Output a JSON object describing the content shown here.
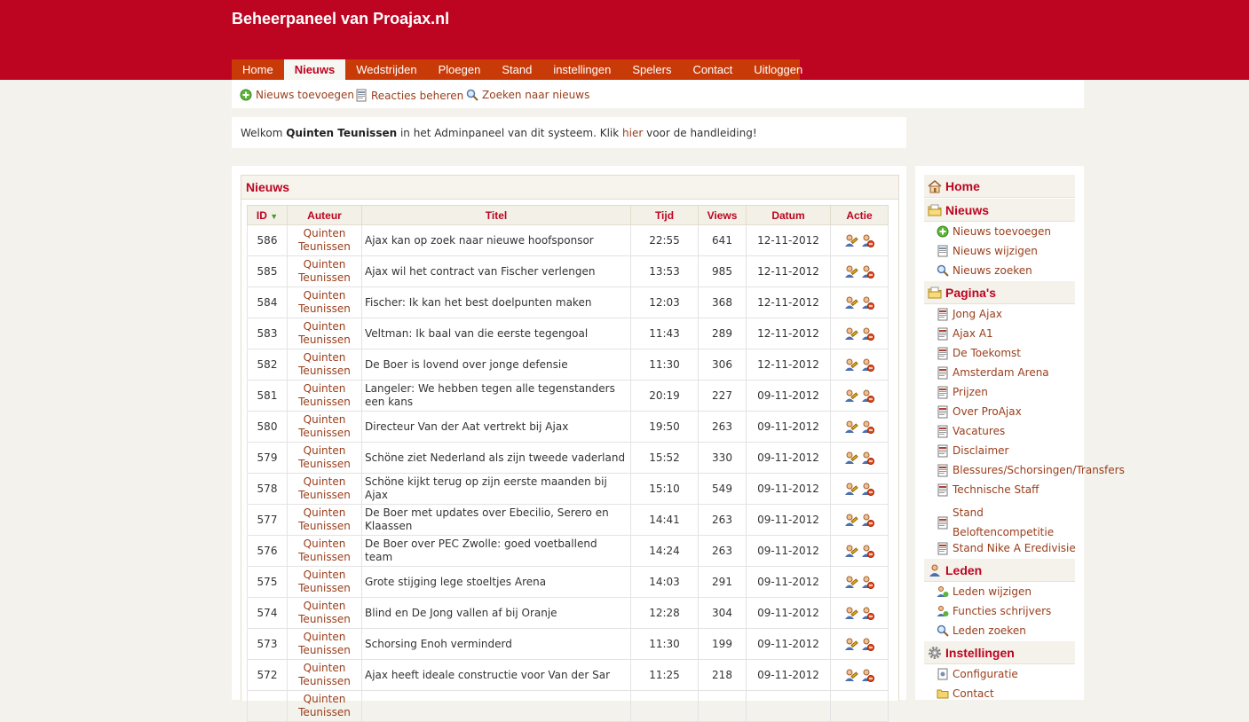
{
  "app": {
    "title": "Beheerpaneel van Proajax.nl"
  },
  "nav": [
    {
      "label": "Home",
      "active": false
    },
    {
      "label": "Nieuws",
      "active": true
    },
    {
      "label": "Wedstrijden",
      "active": false
    },
    {
      "label": "Ploegen",
      "active": false
    },
    {
      "label": "Stand",
      "active": false
    },
    {
      "label": "instellingen",
      "active": false
    },
    {
      "label": "Spelers",
      "active": false
    },
    {
      "label": "Contact",
      "active": false
    },
    {
      "label": "Uitloggen",
      "active": false
    }
  ],
  "subnav": {
    "add_news": "Nieuws toevoegen",
    "manage_reactions": "Reacties beheren",
    "search_news": "Zoeken naar nieuws"
  },
  "welcome": {
    "pre": "Welkom ",
    "user": "Quinten Teunissen",
    "mid": " in het Adminpaneel van dit systeem. Klik ",
    "link": "hier",
    "post": " voor de handleiding!"
  },
  "news": {
    "title": "Nieuws",
    "columns": {
      "id": "ID",
      "auteur": "Auteur",
      "titel": "Titel",
      "tijd": "Tijd",
      "views": "Views",
      "datum": "Datum",
      "actie": "Actie"
    },
    "rows": [
      {
        "id": "586",
        "auteur": "Quinten Teunissen",
        "titel": "Ajax kan op zoek naar nieuwe hoofsponsor",
        "tijd": "22:55",
        "views": "641",
        "datum": "12-11-2012"
      },
      {
        "id": "585",
        "auteur": "Quinten Teunissen",
        "titel": "Ajax wil het contract van Fischer verlengen",
        "tijd": "13:53",
        "views": "985",
        "datum": "12-11-2012"
      },
      {
        "id": "584",
        "auteur": "Quinten Teunissen",
        "titel": "Fischer: Ik kan het best doelpunten maken",
        "tijd": "12:03",
        "views": "368",
        "datum": "12-11-2012"
      },
      {
        "id": "583",
        "auteur": "Quinten Teunissen",
        "titel": "Veltman: Ik baal van die eerste tegengoal",
        "tijd": "11:43",
        "views": "289",
        "datum": "12-11-2012"
      },
      {
        "id": "582",
        "auteur": "Quinten Teunissen",
        "titel": "De Boer is lovend over jonge defensie",
        "tijd": "11:30",
        "views": "306",
        "datum": "12-11-2012"
      },
      {
        "id": "581",
        "auteur": "Quinten Teunissen",
        "titel": "Langeler: We hebben tegen alle tegenstanders een kans",
        "tijd": "20:19",
        "views": "227",
        "datum": "09-11-2012"
      },
      {
        "id": "580",
        "auteur": "Quinten Teunissen",
        "titel": "Directeur Van der Aat vertrekt bij Ajax",
        "tijd": "19:50",
        "views": "263",
        "datum": "09-11-2012"
      },
      {
        "id": "579",
        "auteur": "Quinten Teunissen",
        "titel": "Schöne ziet Nederland als zijn tweede vaderland",
        "tijd": "15:52",
        "views": "330",
        "datum": "09-11-2012"
      },
      {
        "id": "578",
        "auteur": "Quinten Teunissen",
        "titel": "Schöne kijkt terug op zijn eerste maanden bij Ajax",
        "tijd": "15:10",
        "views": "549",
        "datum": "09-11-2012"
      },
      {
        "id": "577",
        "auteur": "Quinten Teunissen",
        "titel": "De Boer met updates over Ebecilio, Serero en Klaassen",
        "tijd": "14:41",
        "views": "263",
        "datum": "09-11-2012"
      },
      {
        "id": "576",
        "auteur": "Quinten Teunissen",
        "titel": "De Boer over PEC Zwolle: goed voetballend team",
        "tijd": "14:24",
        "views": "263",
        "datum": "09-11-2012"
      },
      {
        "id": "575",
        "auteur": "Quinten Teunissen",
        "titel": "Grote stijging lege stoeltjes Arena",
        "tijd": "14:03",
        "views": "291",
        "datum": "09-11-2012"
      },
      {
        "id": "574",
        "auteur": "Quinten Teunissen",
        "titel": "Blind en De Jong vallen af bij Oranje",
        "tijd": "12:28",
        "views": "304",
        "datum": "09-11-2012"
      },
      {
        "id": "573",
        "auteur": "Quinten Teunissen",
        "titel": "Schorsing Enoh verminderd",
        "tijd": "11:30",
        "views": "199",
        "datum": "09-11-2012"
      },
      {
        "id": "572",
        "auteur": "Quinten Teunissen",
        "titel": "Ajax heeft ideale constructie voor Van der Sar",
        "tijd": "11:25",
        "views": "218",
        "datum": "09-11-2012"
      },
      {
        "id": "",
        "auteur": "Quinten Teunissen",
        "titel": "",
        "tijd": "",
        "views": "",
        "datum": ""
      }
    ]
  },
  "sidebar": {
    "home": "Home",
    "nieuws": {
      "title": "Nieuws",
      "items": [
        "Nieuws toevoegen",
        "Nieuws wijzigen",
        "Nieuws zoeken"
      ]
    },
    "paginas": {
      "title": "Pagina's",
      "items": [
        "Jong Ajax",
        "Ajax A1",
        "De Toekomst",
        "Amsterdam Arena",
        "Prijzen",
        "Over ProAjax",
        "Vacatures",
        "Disclaimer",
        "Blessures/Schorsingen/Transfers",
        "Technische Staff",
        "Stand Beloftencompetitie",
        "Stand Nike A Eredivisie"
      ]
    },
    "leden": {
      "title": "Leden",
      "items": [
        "Leden wijzigen",
        "Functies schrijvers",
        "Leden zoeken"
      ]
    },
    "instellingen": {
      "title": "Instellingen",
      "items": [
        "Configuratie",
        "Contact"
      ]
    }
  }
}
